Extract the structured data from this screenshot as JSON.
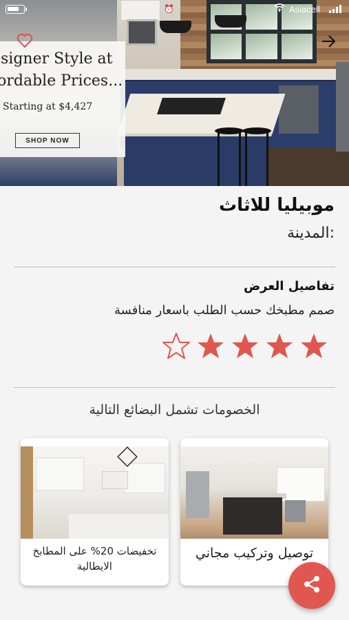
{
  "status_bar": {
    "carrier": "Asiacell",
    "alarm_icon": "alarm-icon",
    "colors": {
      "charging": "#34c759"
    }
  },
  "hero": {
    "promo_title": "esigner Style at\nfordable Prices...",
    "promo_title_line1": "esigner Style at",
    "promo_title_line2": "fordable Prices...",
    "promo_price": "Starting at $4,427",
    "shop_now_label": "SHOP NOW",
    "favorite_icon": "heart-icon",
    "next_icon": "arrow-right-icon"
  },
  "store": {
    "name": "موبيليا للاثاث",
    "city": ":المدينة"
  },
  "offer": {
    "details_title": "تفاصيل العرض",
    "details_text": "صمم مطبخك حسب الطلب باسعار منافسة",
    "rating": 4,
    "rating_max": 5
  },
  "discounts": {
    "title": "الخصومات تشمل البضائع التالية",
    "items": [
      {
        "caption": "توصيل وتركيب مجاني"
      },
      {
        "caption": "تخفيضات 20% على المطابخ الايطالية"
      }
    ]
  },
  "share": {
    "icon": "share-icon"
  },
  "colors": {
    "accent": "#e0574f",
    "text": "#222222",
    "divider": "#bdbdbd"
  }
}
